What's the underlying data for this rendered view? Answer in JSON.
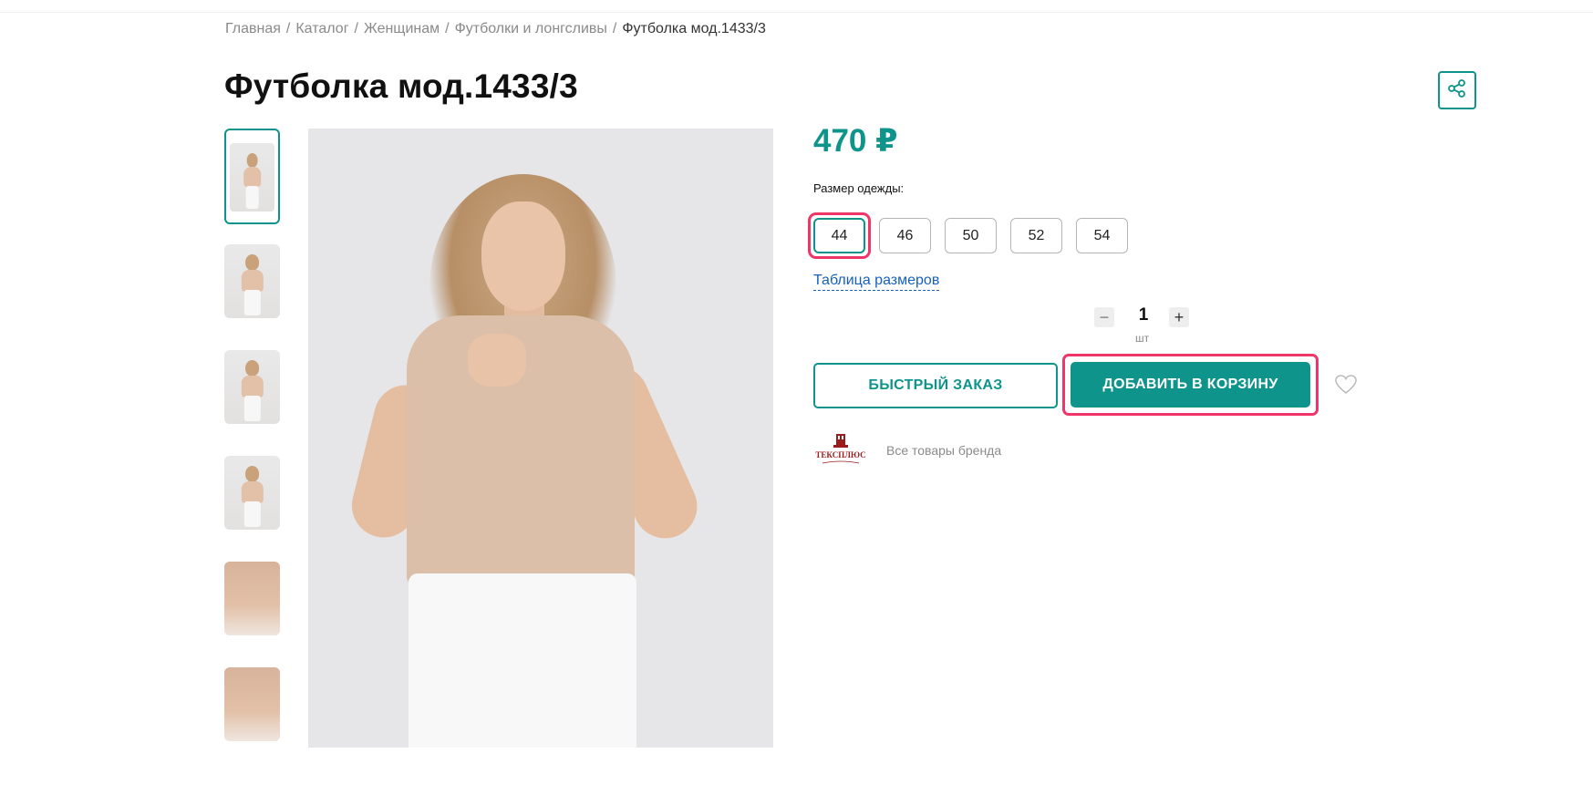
{
  "breadcrumb": {
    "items": [
      "Главная",
      "Каталог",
      "Женщинам",
      "Футболки и лонгсливы"
    ],
    "current": "Футболка мод.1433/3",
    "separator": "/"
  },
  "product": {
    "title": "Футболка мод.1433/3",
    "price": "470 ₽",
    "size_label": "Размер одежды:",
    "sizes": [
      "44",
      "46",
      "50",
      "52",
      "54"
    ],
    "selected_size": "44",
    "size_table_link": "Таблица размеров",
    "quantity": {
      "minus": "−",
      "value": "1",
      "plus": "+",
      "unit": "шт"
    },
    "quick_order_label": "БЫСТРЫЙ ЗАКАЗ",
    "add_to_cart_label": "ДОБАВИТЬ В КОРЗИНУ",
    "brand_logo_text": "ТЕКСПЛЮС",
    "brand_link": "Все товары бренда"
  },
  "gallery": {
    "thumbnail_count": 6,
    "active_index": 0
  },
  "icons": {
    "share": "share-icon",
    "favorite": "heart-icon"
  },
  "colors": {
    "accent": "#0e948a",
    "highlight": "#f0356a",
    "link": "#1560bd"
  }
}
